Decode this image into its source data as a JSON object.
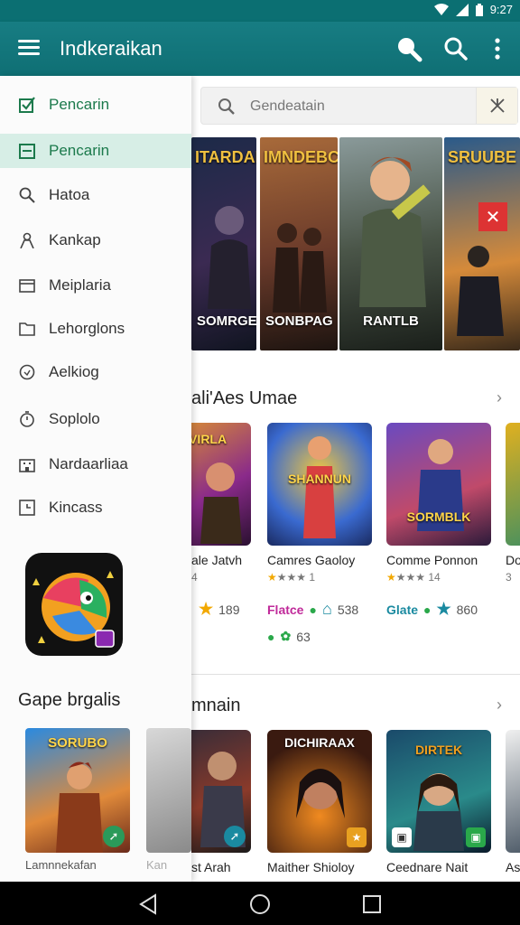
{
  "status": {
    "time": "9:27"
  },
  "app_bar": {
    "title": "Indkeraikan"
  },
  "search": {
    "placeholder": "Gendeatain"
  },
  "drawer": {
    "items": [
      {
        "label": "Pencarin",
        "icon": "check-icon"
      },
      {
        "label": "Pencarin",
        "icon": "calendar-icon"
      },
      {
        "label": "Hatoa",
        "icon": "search-icon"
      },
      {
        "label": "Kankap",
        "icon": "person-icon"
      },
      {
        "label": "Meiplaria",
        "icon": "tray-icon"
      },
      {
        "label": "Lehorglons",
        "icon": "folder-icon"
      },
      {
        "label": "Aelkiog",
        "icon": "circle-icon"
      },
      {
        "label": "Soplolo",
        "icon": "timer-icon"
      },
      {
        "label": "Nardaarliaa",
        "icon": "building-icon"
      },
      {
        "label": "Kincass",
        "icon": "clock-icon"
      }
    ],
    "heading": "Gape brgalis",
    "cards": [
      {
        "name": "Lamnnekafan",
        "art_text": "SORUBO"
      },
      {
        "name": "Kan"
      }
    ]
  },
  "carousel": {
    "banners": [
      {
        "top": "ITARDAN",
        "caption": "SOMRGES"
      },
      {
        "top": "IMNDEBC",
        "caption": "SONBPAG"
      },
      {
        "top": "",
        "caption": "RANTLB"
      },
      {
        "top": "SRUUBE",
        "caption": ""
      }
    ]
  },
  "section1": {
    "title": "ali'Aes Umae",
    "cards": [
      {
        "name": "ale Jatvh",
        "rating": "4",
        "art_text": "ANVIRLA"
      },
      {
        "name": "Camres Gaoloy",
        "rating": "1",
        "art_text": "SHANNUN"
      },
      {
        "name": "Comme Ponnon",
        "rating": "14",
        "art_text": "SORMBLK"
      },
      {
        "name": "Do",
        "rating": "3"
      }
    ],
    "tags": [
      {
        "label": "189"
      },
      {
        "label": "Flatce",
        "count": "538"
      },
      {
        "label": "Glate",
        "count": "860"
      },
      {
        "label": "63"
      }
    ]
  },
  "section2": {
    "title": "mnain",
    "cards": [
      {
        "name": "st Arah"
      },
      {
        "name": "Maither Shioloy",
        "art_text": "DICHIRAAX"
      },
      {
        "name": "Ceednare Nait",
        "art_text": "DIRTEK"
      },
      {
        "name": "As"
      }
    ]
  },
  "colors": {
    "primary": "#0f7076",
    "accent_green": "#1c7a4c",
    "active_bg": "#d7eee6",
    "close_red": "#d33333",
    "star": "#f2a800"
  }
}
